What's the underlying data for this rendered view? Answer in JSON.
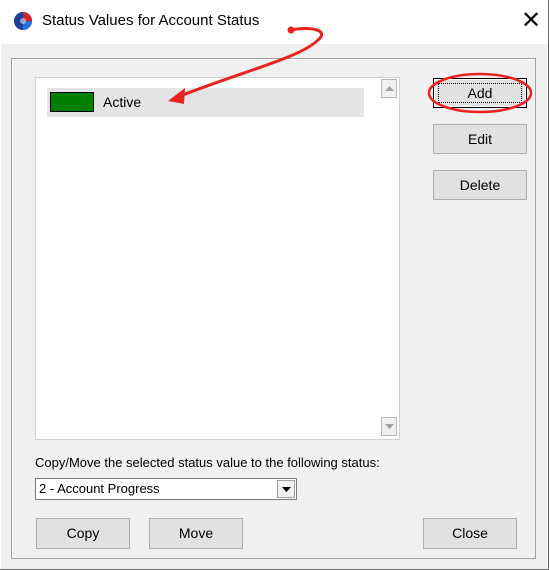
{
  "window": {
    "title": "Status Values for Account Status",
    "close_glyph": "✕",
    "icon": "app-logo-icon"
  },
  "status_list": {
    "items": [
      {
        "label": "Active",
        "color": "#008000",
        "selected": true
      }
    ]
  },
  "buttons": {
    "add": "Add",
    "edit": "Edit",
    "delete": "Delete",
    "copy": "Copy",
    "move": "Move",
    "close": "Close"
  },
  "copy_move": {
    "label": "Copy/Move the selected status value to the following status:",
    "selected_status": "2 - Account Progress"
  },
  "annotation": {
    "color": "#e8231f"
  }
}
